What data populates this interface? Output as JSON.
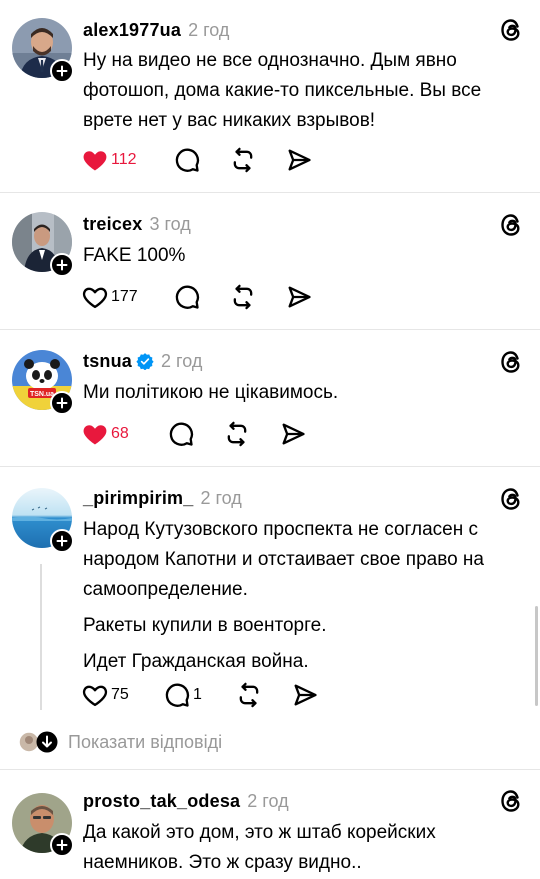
{
  "posts": [
    {
      "username": "alex1977ua",
      "time": "2 год",
      "text": [
        "Ну на видео не все однозначно. Дым явно фотошоп, дома какие-то пиксельные. Вы все врете нет у вас никаких взрывов!"
      ],
      "likes": "112",
      "liked": true,
      "replies": ""
    },
    {
      "username": "treicex",
      "time": "3 год",
      "text": [
        "FAKE 100%"
      ],
      "likes": "177",
      "liked": false,
      "replies": ""
    },
    {
      "username": "tsnua",
      "time": "2 год",
      "verified": true,
      "text": [
        "Ми політикою не цікавимось."
      ],
      "likes": "68",
      "liked": true,
      "replies": ""
    },
    {
      "username": "_pirimpirim_",
      "time": "2 год",
      "text": [
        "Народ Кутузовского проспекта не согласен с народом Капотни и отстаивает свое право на самоопределение.",
        "Ракеты купили в военторге.",
        "Идет Гражданская война."
      ],
      "likes": "75",
      "liked": false,
      "replies": "1"
    },
    {
      "username": "prosto_tak_odesa",
      "time": "2 год",
      "text": [
        "Да какой это дом, это ж штаб корейских наемников. Это ж сразу видно.."
      ]
    }
  ],
  "show_replies_label": "Показати відповіді",
  "avatar_badge_text": "TSN.ua",
  "colors": {
    "like_red": "#e8183d",
    "muted_gray": "#999999",
    "verified_blue": "#0095f6",
    "divider": "#e6e6e6"
  },
  "icons": [
    "plus-icon",
    "threads-logo-icon",
    "heart-icon",
    "comment-icon",
    "repost-icon",
    "share-icon",
    "verified-badge-icon",
    "arrow-down-icon"
  ]
}
